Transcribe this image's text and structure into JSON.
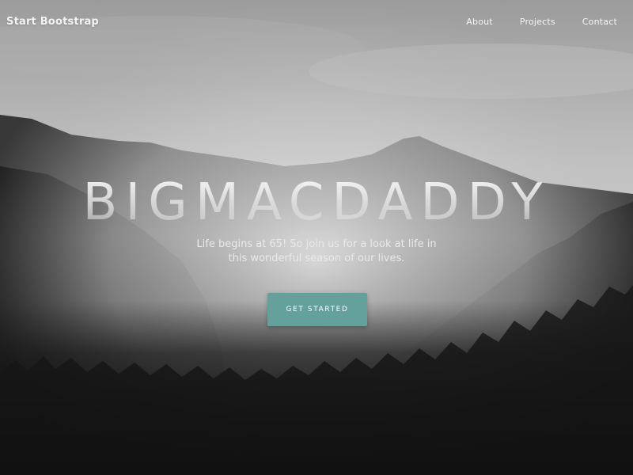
{
  "navbar": {
    "brand": "Start Bootstrap",
    "links": [
      {
        "label": "About"
      },
      {
        "label": "Projects"
      },
      {
        "label": "Contact"
      }
    ]
  },
  "masthead": {
    "title": "BIGMACDADDY",
    "tagline_line1": "Life begins at 65! So join us for a look at life in",
    "tagline_line2": "this wonderful season of our lives.",
    "cta_label": "GET STARTED"
  },
  "colors": {
    "accent": "#64a19d",
    "text_light": "#f3f3f3"
  }
}
